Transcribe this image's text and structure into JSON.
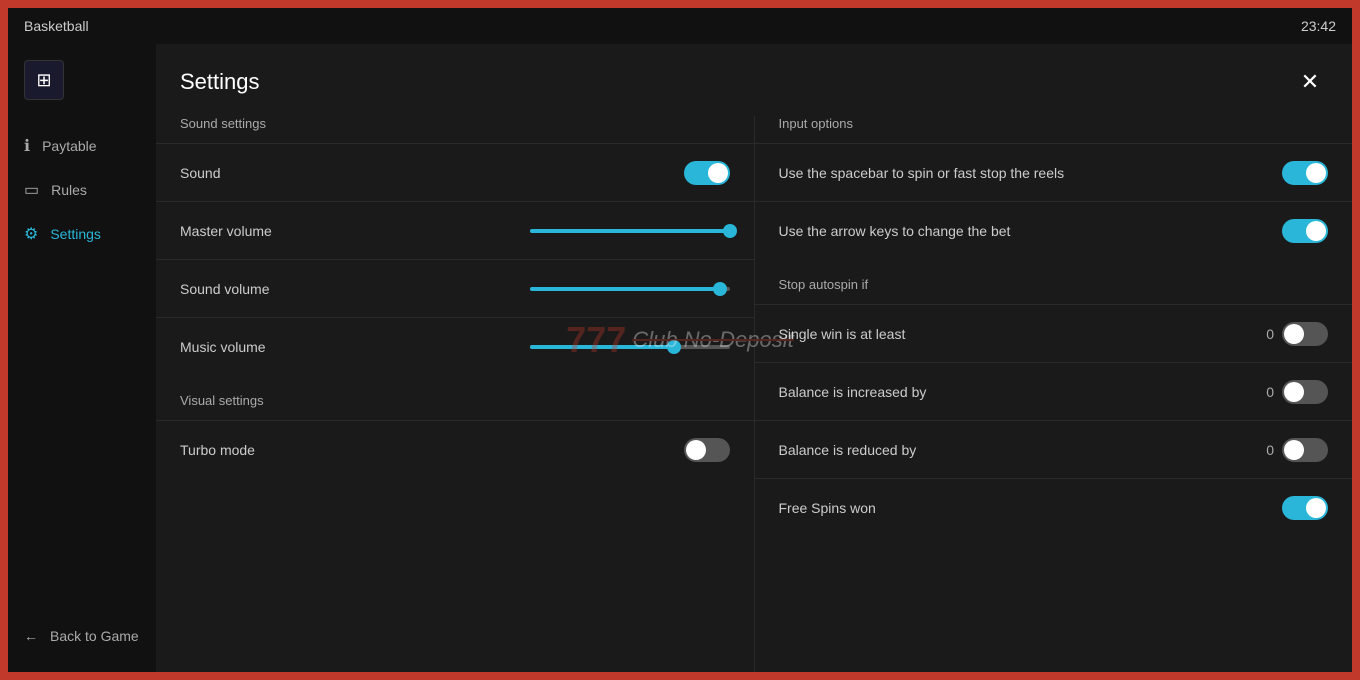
{
  "topbar": {
    "title": "Basketball",
    "time": "23:42"
  },
  "sidebar": {
    "logo_icon": "⊞",
    "items": [
      {
        "id": "paytable",
        "label": "Paytable",
        "icon": "ℹ",
        "active": false
      },
      {
        "id": "rules",
        "label": "Rules",
        "icon": "📖",
        "active": false
      },
      {
        "id": "settings",
        "label": "Settings",
        "icon": "⚙",
        "active": true
      }
    ],
    "back_label": "Back to Game",
    "back_icon": "←"
  },
  "settings": {
    "title": "Settings",
    "close_icon": "✕",
    "sound_settings": {
      "section_label": "Sound settings",
      "rows": [
        {
          "id": "sound",
          "label": "Sound",
          "type": "toggle",
          "value": true
        },
        {
          "id": "master-volume",
          "label": "Master volume",
          "type": "slider",
          "percent": 100
        },
        {
          "id": "sound-volume",
          "label": "Sound volume",
          "type": "slider",
          "percent": 95
        },
        {
          "id": "music-volume",
          "label": "Music volume",
          "type": "slider",
          "percent": 72
        }
      ]
    },
    "visual_settings": {
      "section_label": "Visual settings",
      "rows": [
        {
          "id": "turbo-mode",
          "label": "Turbo mode",
          "type": "toggle",
          "value": false
        }
      ]
    },
    "input_options": {
      "section_label": "Input options",
      "rows": [
        {
          "id": "spacebar-spin",
          "label": "Use the spacebar to spin or fast stop the reels",
          "type": "toggle",
          "value": true
        },
        {
          "id": "arrow-bet",
          "label": "Use the arrow keys to change the bet",
          "type": "toggle",
          "value": true
        }
      ]
    },
    "stop_autospin": {
      "section_label": "Stop autospin if",
      "rows": [
        {
          "id": "single-win",
          "label": "Single win is at least",
          "type": "toggle-number",
          "value": false,
          "number": "0"
        },
        {
          "id": "balance-increased",
          "label": "Balance is increased by",
          "type": "toggle-number",
          "value": false,
          "number": "0"
        },
        {
          "id": "balance-reduced",
          "label": "Balance is reduced by",
          "type": "toggle-number",
          "value": false,
          "number": "0"
        },
        {
          "id": "free-spins-won",
          "label": "Free Spins won",
          "type": "toggle",
          "value": true
        }
      ]
    }
  }
}
